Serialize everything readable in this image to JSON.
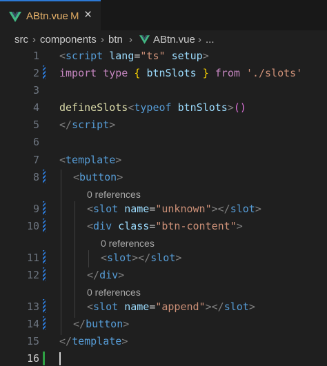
{
  "tab": {
    "filename": "ABtn.vue",
    "modified": "M",
    "close": "×",
    "icon": "vue-icon"
  },
  "breadcrumb": {
    "items": [
      "src",
      "components",
      "btn",
      "ABtn.vue",
      "..."
    ],
    "separator": "›"
  },
  "editor": {
    "line_numbers": [
      "1",
      "2",
      "3",
      "4",
      "5",
      "6",
      "7",
      "8",
      "9",
      "10",
      "11",
      "12",
      "13",
      "14",
      "15",
      "16"
    ],
    "codelens": [
      "0 references",
      "0 references",
      "0 references"
    ],
    "lines": {
      "l1": [
        "<",
        "script",
        " ",
        "lang",
        "=",
        "\"ts\"",
        " ",
        "setup",
        ">"
      ],
      "l2": [
        "import",
        " ",
        "type",
        " ",
        "{",
        " ",
        "btnSlots",
        " ",
        "}",
        " ",
        "from",
        " ",
        "'./slots'"
      ],
      "l4": [
        "defineSlots",
        "<",
        "typeof",
        " ",
        "btnSlots",
        ">",
        "()"
      ],
      "l5": [
        "</",
        "script",
        ">"
      ],
      "l7": [
        "<",
        "template",
        ">"
      ],
      "l8": [
        "<",
        "button",
        ">"
      ],
      "l9": [
        "<",
        "slot",
        " ",
        "name",
        "=",
        "\"unknown\"",
        "></",
        "slot",
        ">"
      ],
      "l10": [
        "<",
        "div",
        " ",
        "class",
        "=",
        "\"btn-content\"",
        ">"
      ],
      "l11": [
        "<",
        "slot",
        "></",
        "slot",
        ">"
      ],
      "l12": [
        "</",
        "div",
        ">"
      ],
      "l13": [
        "<",
        "slot",
        " ",
        "name",
        "=",
        "\"append\"",
        "></",
        "slot",
        ">"
      ],
      "l14": [
        "</",
        "button",
        ">"
      ],
      "l15": [
        "</",
        "template",
        ">"
      ]
    },
    "current_line": "16"
  },
  "colors": {
    "tab_accent": "#2c79d6",
    "modified": "#e8b36b",
    "vue_green": "#42b883",
    "background": "#1f1f1f"
  }
}
